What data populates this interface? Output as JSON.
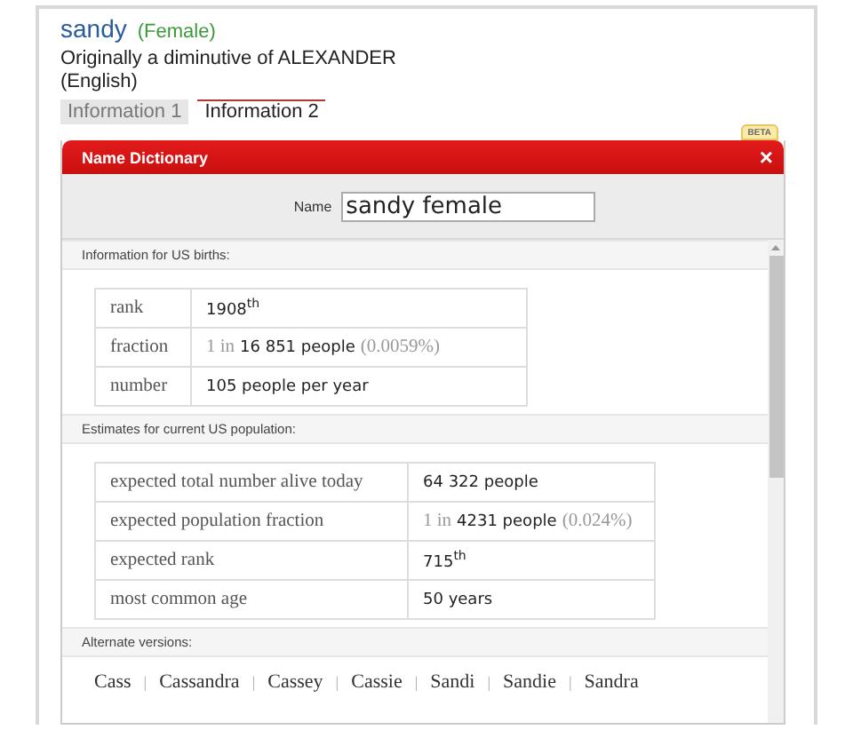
{
  "entry": {
    "name": "sandy",
    "gender": "(Female)",
    "description": "Originally a diminutive of ALEXANDER",
    "language": "(English)"
  },
  "tabs": [
    {
      "label": "Information 1",
      "selected": false
    },
    {
      "label": "Information 2",
      "selected": true
    }
  ],
  "badge": "BETA",
  "dialog": {
    "title": "Name Dictionary",
    "close": "×",
    "name_label": "Name",
    "name_value": "sandy female",
    "sections": [
      {
        "kind": "table",
        "heading": "Information for US births:",
        "rows": [
          {
            "label": "rank",
            "value": [
              {
                "text": "1908$^{th}$",
                "muted": false
              }
            ]
          },
          {
            "label": "fraction",
            "value": [
              {
                "text": "1 in",
                "muted": true
              },
              {
                "text": "16 851 people",
                "muted": false
              },
              {
                "text": "(0.0059%)",
                "muted": true
              }
            ]
          },
          {
            "label": "number",
            "value": [
              {
                "text": "105 people per year",
                "muted": false
              }
            ]
          }
        ]
      },
      {
        "kind": "table",
        "heading": "Estimates for current US population:",
        "rows": [
          {
            "label": "expected total number alive today",
            "value": [
              {
                "text": "64 322 people",
                "muted": false
              }
            ]
          },
          {
            "label": "expected population fraction",
            "value": [
              {
                "text": "1 in",
                "muted": true
              },
              {
                "text": "4231 people",
                "muted": false
              },
              {
                "text": "(0.024%)",
                "muted": true
              }
            ]
          },
          {
            "label": "expected rank",
            "value": [
              {
                "text": "715$^{th}$",
                "muted": false
              }
            ]
          },
          {
            "label": "most common age",
            "value": [
              {
                "text": "50 years",
                "muted": false
              }
            ]
          }
        ]
      },
      {
        "kind": "links",
        "heading": "Alternate versions:",
        "separator": "|",
        "links": [
          "Cass",
          "Cassandra",
          "Cassey",
          "Cassie",
          "Sandi",
          "Sandie",
          "Sandra"
        ]
      }
    ]
  }
}
